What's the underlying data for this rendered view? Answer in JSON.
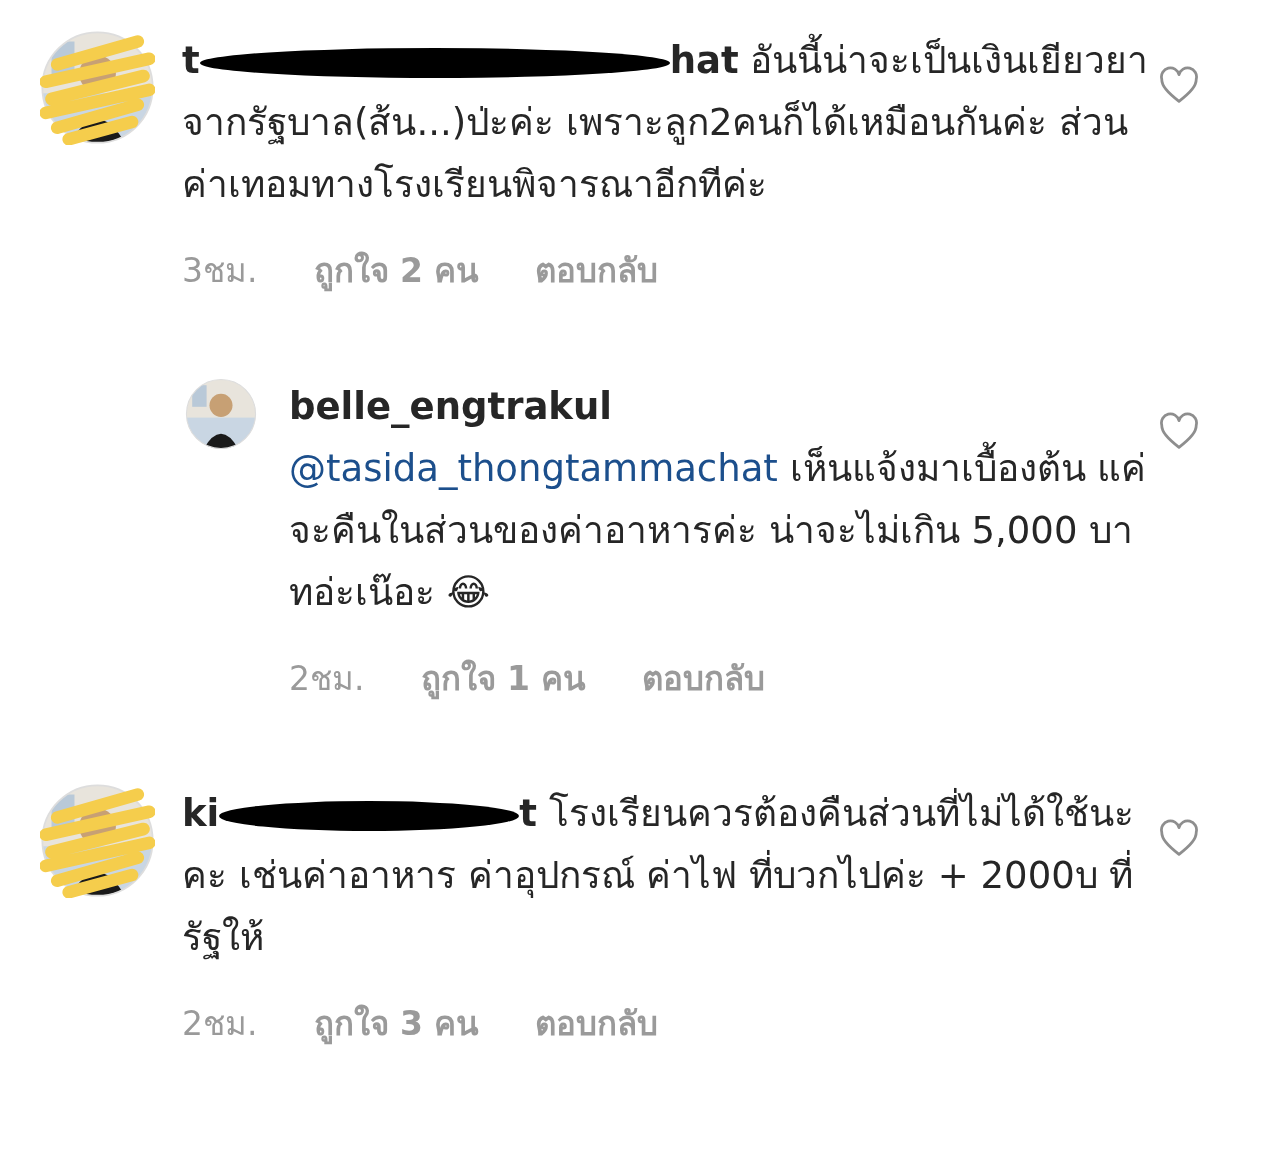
{
  "comments": [
    {
      "kind": "comment",
      "username_visible_start": "t",
      "username_visible_end": "hat",
      "redacted": true,
      "text": "อันนี้น่าจะเป็นเงินเยียวยาจากรัฐบาล(ส้น...)ป่ะค่ะ เพราะลูก2คนก็ได้เหมือนกันค่ะ ส่วนค่าเทอมทางโรงเรียนพิจารณาอีกทีค่ะ",
      "time": "3ชม.",
      "likes": "ถูกใจ 2 คน",
      "reply": "ตอบกลับ",
      "liked": false
    },
    {
      "kind": "reply",
      "username": "belle_engtrakul",
      "mention": "@tasida_thongtammachat",
      "text": "เห็นแจ้งมาเบื้องต้น แค่จะคืนในส่วนของค่าอาหารค่ะ น่าจะไม่เกิน 5,000 บาทอ่ะเน๊อะ 😂",
      "time": "2ชม.",
      "likes": "ถูกใจ 1 คน",
      "reply": "ตอบกลับ",
      "liked": false
    },
    {
      "kind": "comment",
      "username_visible_start": "ki",
      "username_visible_end": "t",
      "redacted": true,
      "text": "โรงเรียนควรต้องคืนส่วนที่ไม่ได้ใช้นะคะ เช่นค่าอาหาร ค่าอุปกรณ์ ค่าไฟ ที่บวกไปค่ะ + 2000บ ที่รัฐให้",
      "time": "2ชม.",
      "likes": "ถูกใจ 3 คน",
      "reply": "ตอบกลับ",
      "liked": false
    }
  ]
}
